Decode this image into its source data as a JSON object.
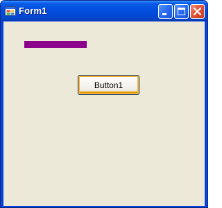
{
  "window": {
    "title": "Form1",
    "icon": "form-app-icon"
  },
  "caption_buttons": {
    "minimize_icon": "minimize-icon",
    "maximize_icon": "maximize-icon",
    "close_icon": "close-icon"
  },
  "form": {
    "button1_label": "Button1",
    "bar_color": "#8b008b"
  },
  "colors": {
    "title_bar": "#0351e0",
    "client_bg": "#ece9d8",
    "close_button": "#e2563a"
  }
}
